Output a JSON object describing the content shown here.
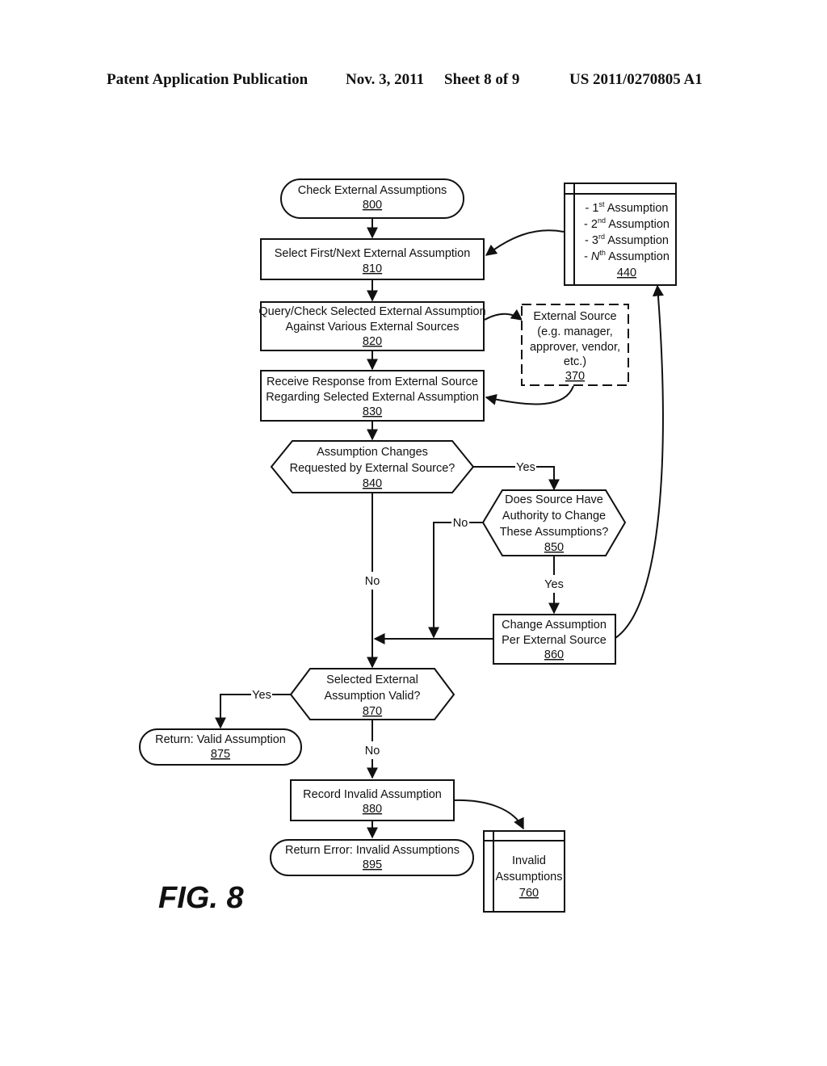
{
  "header": {
    "publication": "Patent Application Publication",
    "date": "Nov. 3, 2011",
    "sheet": "Sheet 8 of 9",
    "number": "US 2011/0270805 A1"
  },
  "figure_label": "FIG. 8",
  "nodes": {
    "n800": {
      "lines": [
        "Check External Assumptions"
      ],
      "ref": "800",
      "type": "terminal"
    },
    "n810": {
      "lines": [
        "Select First/Next External Assumption"
      ],
      "ref": "810",
      "type": "process"
    },
    "n820": {
      "lines": [
        "Query/Check Selected External Assumption",
        "Against Various External Sources"
      ],
      "ref": "820",
      "type": "process"
    },
    "n830": {
      "lines": [
        "Receive Response from External Source",
        "Regarding Selected External Assumption"
      ],
      "ref": "830",
      "type": "process"
    },
    "n840": {
      "lines": [
        "Assumption Changes",
        "Requested by External Source?"
      ],
      "ref": "840",
      "type": "decision"
    },
    "n850": {
      "lines": [
        "Does Source Have",
        "Authority to Change",
        "These Assumptions?"
      ],
      "ref": "850",
      "type": "decision"
    },
    "n860": {
      "lines": [
        "Change Assumption",
        "Per External Source"
      ],
      "ref": "860",
      "type": "process"
    },
    "n870": {
      "lines": [
        "Selected External",
        "Assumption Valid?"
      ],
      "ref": "870",
      "type": "decision"
    },
    "n875": {
      "lines": [
        "Return: Valid Assumption"
      ],
      "ref": "875",
      "type": "terminal"
    },
    "n880": {
      "lines": [
        "Record Invalid Assumption"
      ],
      "ref": "880",
      "type": "process"
    },
    "n895": {
      "lines": [
        "Return Error: Invalid Assumptions"
      ],
      "ref": "895",
      "type": "terminal"
    },
    "n370": {
      "lines": [
        "External Source",
        "(e.g. manager,",
        "approver, vendor,",
        "etc.)"
      ],
      "ref": "370",
      "type": "external"
    },
    "n440": {
      "items": [
        {
          "prefix": "- 1",
          "sup": "st",
          "text": " Assumption"
        },
        {
          "prefix": "- 2",
          "sup": "nd",
          "text": " Assumption"
        },
        {
          "prefix": "- 3",
          "sup": "rd",
          "text": " Assumption"
        },
        {
          "prefix": "- N",
          "sup": "th",
          "text": " Assumption"
        }
      ],
      "ref": "440",
      "type": "datastore"
    },
    "n760": {
      "lines": [
        "Invalid",
        "Assumptions"
      ],
      "ref": "760",
      "type": "datastore"
    }
  },
  "edge_labels": {
    "e840_yes": "Yes",
    "e840_no": "No",
    "e850_no": "No",
    "e850_yes": "Yes",
    "e870_yes": "Yes",
    "e870_no": "No"
  }
}
